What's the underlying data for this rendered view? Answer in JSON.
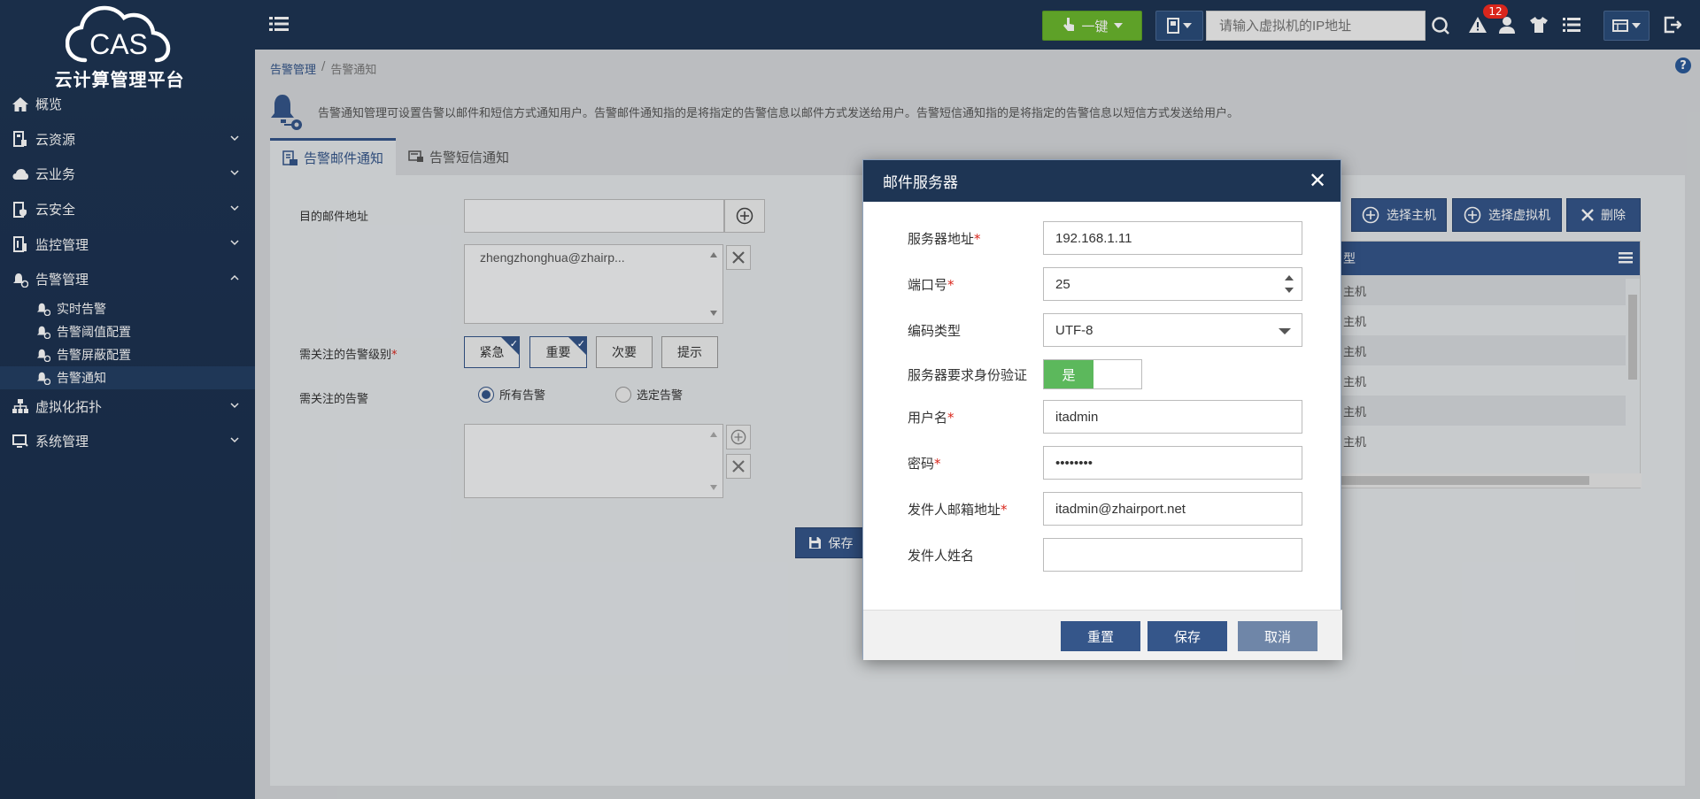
{
  "app": {
    "logo_mark": "CAS",
    "logo_title": "云计算管理平台"
  },
  "header": {
    "onekey_label": "一键",
    "search_placeholder": "请输入虚拟机的IP地址",
    "alert_count": "12"
  },
  "sidebar": {
    "items": [
      {
        "label": "概览"
      },
      {
        "label": "云资源"
      },
      {
        "label": "云业务"
      },
      {
        "label": "云安全"
      },
      {
        "label": "监控管理"
      },
      {
        "label": "告警管理"
      },
      {
        "label": "虚拟化拓扑"
      },
      {
        "label": "系统管理"
      }
    ],
    "sub_items": [
      {
        "label": "实时告警"
      },
      {
        "label": "告警阈值配置"
      },
      {
        "label": "告警屏蔽配置"
      },
      {
        "label": "告警通知"
      }
    ]
  },
  "breadcrumb": {
    "parent": "告警管理",
    "separator": "/",
    "current": "告警通知"
  },
  "description": "告警通知管理可设置告警以邮件和短信方式通知用户。告警邮件通知指的是将指定的告警信息以邮件方式发送给用户。告警短信通知指的是将指定的告警信息以短信方式发送给用户。",
  "tabs": [
    {
      "label": "告警邮件通知"
    },
    {
      "label": "告警短信通知"
    }
  ],
  "form": {
    "email_label": "目的邮件地址",
    "email_list_item": "zhengzhonghua@zhairp...",
    "level_label": "需关注的告警级别",
    "levels": [
      {
        "label": "紧急"
      },
      {
        "label": "重要"
      },
      {
        "label": "次要"
      },
      {
        "label": "提示"
      }
    ],
    "alert_label": "需关注的告警",
    "radio_all": "所有告警",
    "radio_selected": "选定告警",
    "save_label": "保存"
  },
  "host_panel": {
    "select_host": "选择主机",
    "select_vm": "选择虚拟机",
    "delete": "删除",
    "header_partial": "型",
    "rows": [
      "主机",
      "主机",
      "主机",
      "主机",
      "主机",
      "主机"
    ]
  },
  "dialog": {
    "title": "邮件服务器",
    "fields": {
      "server_label": "服务器地址",
      "server_value": "192.168.1.11",
      "port_label": "端口号",
      "port_value": "25",
      "encoding_label": "编码类型",
      "encoding_value": "UTF-8",
      "auth_label": "服务器要求身份验证",
      "auth_value": "是",
      "username_label": "用户名",
      "username_value": "itadmin",
      "password_label": "密码",
      "password_value": "••••••••",
      "sender_email_label": "发件人邮箱地址",
      "sender_email_value": "itadmin@zhairport.net",
      "sender_name_label": "发件人姓名",
      "sender_name_value": ""
    },
    "buttons": {
      "reset": "重置",
      "save": "保存",
      "cancel": "取消"
    },
    "required_mark": "*"
  },
  "colors": {
    "header_bg": "#1e3554",
    "accent": "#35568a",
    "onekey_green": "#6cb82e",
    "toggle_green": "#5cb85c",
    "badge_red": "#d9261c",
    "cancel_btn": "#6f86a8"
  }
}
